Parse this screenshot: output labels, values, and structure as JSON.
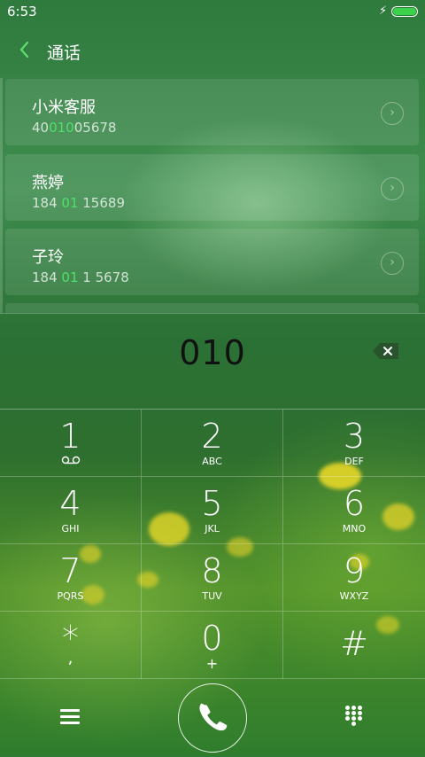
{
  "status_bar": {
    "time": "6:53"
  },
  "header": {
    "title": "通话"
  },
  "contacts": [
    {
      "name": "小米客服",
      "num_pre": "40",
      "num_hl": "010",
      "num_post": "05678"
    },
    {
      "name": "燕婷",
      "num_pre": "184 ",
      "num_hl": "01",
      "num_post": " 15689"
    },
    {
      "name": "子玲",
      "num_pre": "184 ",
      "num_hl": "01",
      "num_post": " 1 5678"
    }
  ],
  "dialer": {
    "number": "010"
  },
  "keypad": [
    {
      "digit": "1",
      "sub": ""
    },
    {
      "digit": "2",
      "sub": "ABC"
    },
    {
      "digit": "3",
      "sub": "DEF"
    },
    {
      "digit": "4",
      "sub": "GHI"
    },
    {
      "digit": "5",
      "sub": "JKL"
    },
    {
      "digit": "6",
      "sub": "MNO"
    },
    {
      "digit": "7",
      "sub": "PQRS"
    },
    {
      "digit": "8",
      "sub": "TUV"
    },
    {
      "digit": "9",
      "sub": "WXYZ"
    },
    {
      "digit": "*",
      "sub": ","
    },
    {
      "digit": "0",
      "sub": "+"
    },
    {
      "digit": "#",
      "sub": ""
    }
  ],
  "colors": {
    "accent": "#4fe06a",
    "battery": "#3bd14b",
    "number_text": "#111111"
  }
}
